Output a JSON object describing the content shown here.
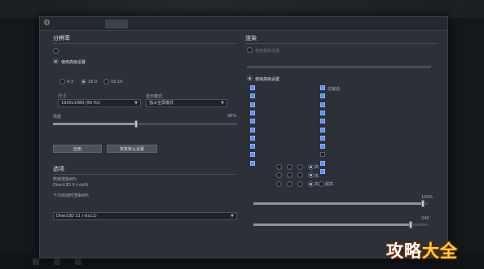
{
  "tabs": [
    "",
    "",
    "",
    ""
  ],
  "tab_active": "",
  "close_label": "",
  "resolution": {
    "title": "分辨率",
    "opt_native": "",
    "opt_advanced": "使用高级设置",
    "aspect_label": "",
    "aspect_options": [
      "4:3",
      "16:9",
      "16:10"
    ],
    "aspect_selected": "16:9",
    "size_label": "尺寸:",
    "size_value": "1920x1080 (60 Hz)",
    "display_label": "显示模式:",
    "display_value": "独占全屏模式",
    "brightness_label": "亮度",
    "brightness_value": "96%",
    "brightness_fraction": 0.45,
    "apply_label": "应用",
    "restore_label": "恢复默认设置"
  },
  "options": {
    "title": "选项",
    "api_label": "所用渲染API:",
    "api_value": "Direct3D 9 (-dx9)",
    "api_note_1": "下次启动时渲染API:",
    "api_note_2": "",
    "api_note_3": "",
    "api_select": "Direct3D 11 (-dx11)"
  },
  "render": {
    "title": "渲染",
    "opt_basic": "使用基础设置",
    "opt_advanced": "使用高级设置",
    "checks_left": [
      "",
      "",
      "",
      "",
      "",
      "",
      "",
      "",
      "",
      ""
    ],
    "checks_right": [
      "抗锯齿",
      "",
      "",
      "",
      "",
      "",
      "",
      "",
      "",
      "",
      ""
    ],
    "right_checked": [
      true,
      true,
      true,
      true,
      true,
      true,
      true,
      true,
      false,
      true
    ],
    "quality_rows": [
      {
        "label": "",
        "levels": [
          "",
          "",
          "",
          "高"
        ],
        "selected": 3
      },
      {
        "label": "",
        "levels": [
          "",
          "",
          "",
          "高"
        ],
        "selected": 3
      },
      {
        "label": "",
        "levels": [
          "",
          "",
          "",
          "高",
          "超高"
        ],
        "selected": 3
      }
    ],
    "slider1_label": "",
    "slider1_value": "100%",
    "slider1_fraction": 0.97,
    "slider2_label": "",
    "slider2_value": "240",
    "slider2_fraction": 0.9
  },
  "watermark": {
    "part1": "攻略",
    "part2": "大全"
  }
}
